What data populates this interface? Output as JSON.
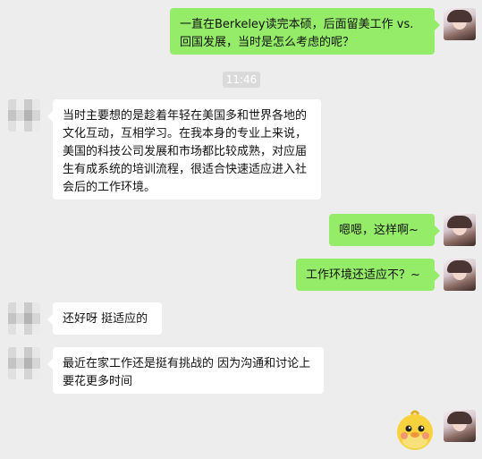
{
  "chat": {
    "timestamp": "11:46",
    "messages": [
      {
        "sender": "me",
        "text": "一直在Berkeley读完本硕，后面留美工作 vs. 回国发展，当时是怎么考虑的呢？"
      },
      {
        "sender": "other",
        "text": "当时主要想的是趁着年轻在美国多和世界各地的文化互动，互相学习。在我本身的专业上来说，美国的科技公司发展和市场都比较成熟，对应届生有成系统的培训流程，很适合快速适应进入社会后的工作环境。"
      },
      {
        "sender": "me",
        "text": "嗯嗯，这样啊~"
      },
      {
        "sender": "me",
        "text": "工作环境还适应不？~"
      },
      {
        "sender": "other",
        "text": "还好呀 挺适应的"
      },
      {
        "sender": "other",
        "text": "最近在家工作还是挺有挑战的 因为沟通和讨论上要花更多时间"
      },
      {
        "sender": "me",
        "type": "sticker",
        "icon": "cartoon-duck-sticker"
      }
    ]
  },
  "colors": {
    "me_bubble": "#95ec69",
    "other_bubble": "#ffffff",
    "background": "#ededed"
  }
}
